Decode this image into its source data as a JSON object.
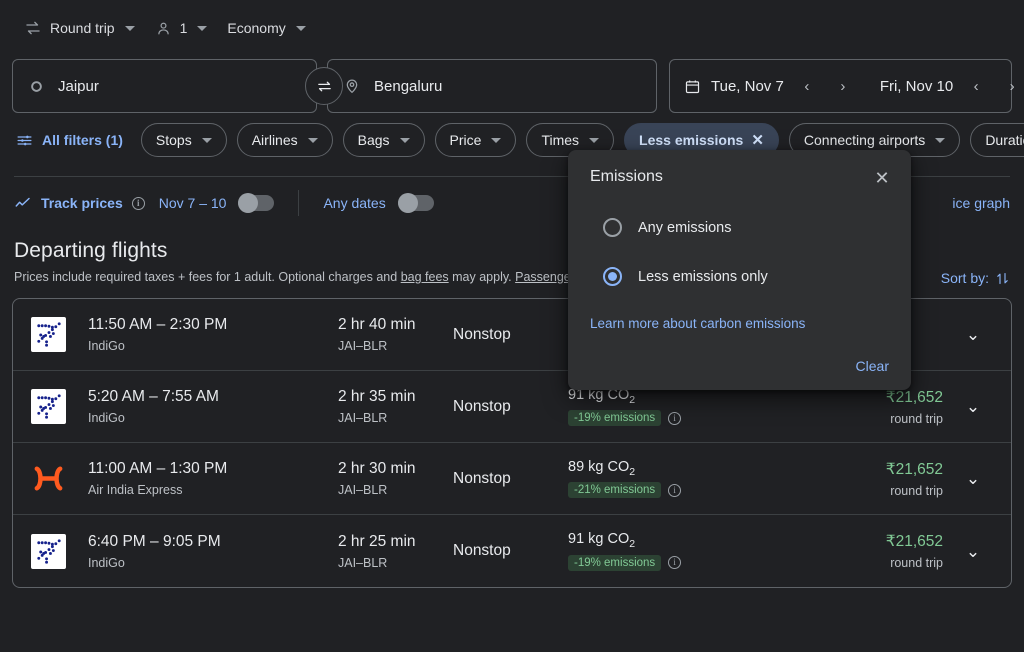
{
  "trip_options": {
    "trip_type": "Round trip",
    "passengers": "1",
    "cabin_class": "Economy"
  },
  "search": {
    "origin": "Jaipur",
    "destination": "Bengaluru",
    "depart_date": "Tue, Nov 7",
    "return_date": "Fri, Nov 10",
    "prev_arrow": "‹",
    "next_arrow": "›"
  },
  "filters": {
    "all_filters": "All filters (1)",
    "chips": [
      {
        "label": "Stops",
        "active": false
      },
      {
        "label": "Airlines",
        "active": false
      },
      {
        "label": "Bags",
        "active": false
      },
      {
        "label": "Price",
        "active": false
      },
      {
        "label": "Times",
        "active": false
      },
      {
        "label": "Less emissions",
        "active": true
      },
      {
        "label": "Connecting airports",
        "active": false
      },
      {
        "label": "Duration",
        "active": false
      }
    ]
  },
  "track": {
    "label": "Track prices",
    "date_range": "Nov 7 – 10",
    "any_dates": "Any dates",
    "price_graph": "ice graph"
  },
  "departing": {
    "title": "Departing flights",
    "disclaimer_1": "Prices include required taxes + fees for 1 adult. Optional charges and ",
    "disclaimer_link_1": "bag fees",
    "disclaimer_2": " may apply. ",
    "disclaimer_link_2": "Passenger ass",
    "sort_by": "Sort by:"
  },
  "flights": [
    {
      "logo": "indigo-logo",
      "times": "11:50 AM – 2:30 PM",
      "airline": "IndiGo",
      "duration": "2 hr 40 min",
      "route": "JAI–BLR",
      "stops": "Nonstop",
      "emissions": "",
      "emissions_badge": "",
      "price": "",
      "price_note": ""
    },
    {
      "logo": "indigo-logo",
      "times": "5:20 AM – 7:55 AM",
      "airline": "IndiGo",
      "duration": "2 hr 35 min",
      "route": "JAI–BLR",
      "stops": "Nonstop",
      "emissions": "91 kg CO",
      "emissions_sub": "2",
      "emissions_badge": "-19% emissions",
      "price": "₹21,652",
      "price_note": "round trip"
    },
    {
      "logo": "airindiaexpress-logo",
      "times": "11:00 AM – 1:30 PM",
      "airline": "Air India Express",
      "duration": "2 hr 30 min",
      "route": "JAI–BLR",
      "stops": "Nonstop",
      "emissions": "89 kg CO",
      "emissions_sub": "2",
      "emissions_badge": "-21% emissions",
      "price": "₹21,652",
      "price_note": "round trip"
    },
    {
      "logo": "indigo-logo",
      "times": "6:40 PM – 9:05 PM",
      "airline": "IndiGo",
      "duration": "2 hr 25 min",
      "route": "JAI–BLR",
      "stops": "Nonstop",
      "emissions": "91 kg CO",
      "emissions_sub": "2",
      "emissions_badge": "-19% emissions",
      "price": "₹21,652",
      "price_note": "round trip"
    }
  ],
  "dialog": {
    "title": "Emissions",
    "option_any": "Any emissions",
    "option_less": "Less emissions only",
    "selected": "Less emissions only",
    "learn_more": "Learn more about carbon emissions",
    "clear": "Clear",
    "close_glyph": "✕"
  },
  "colors": {
    "background": "#202124",
    "accent_blue": "#8ab4f8",
    "price_green": "#81c995",
    "chip_active_bg": "#394457",
    "badge_bg": "#2c4233"
  }
}
